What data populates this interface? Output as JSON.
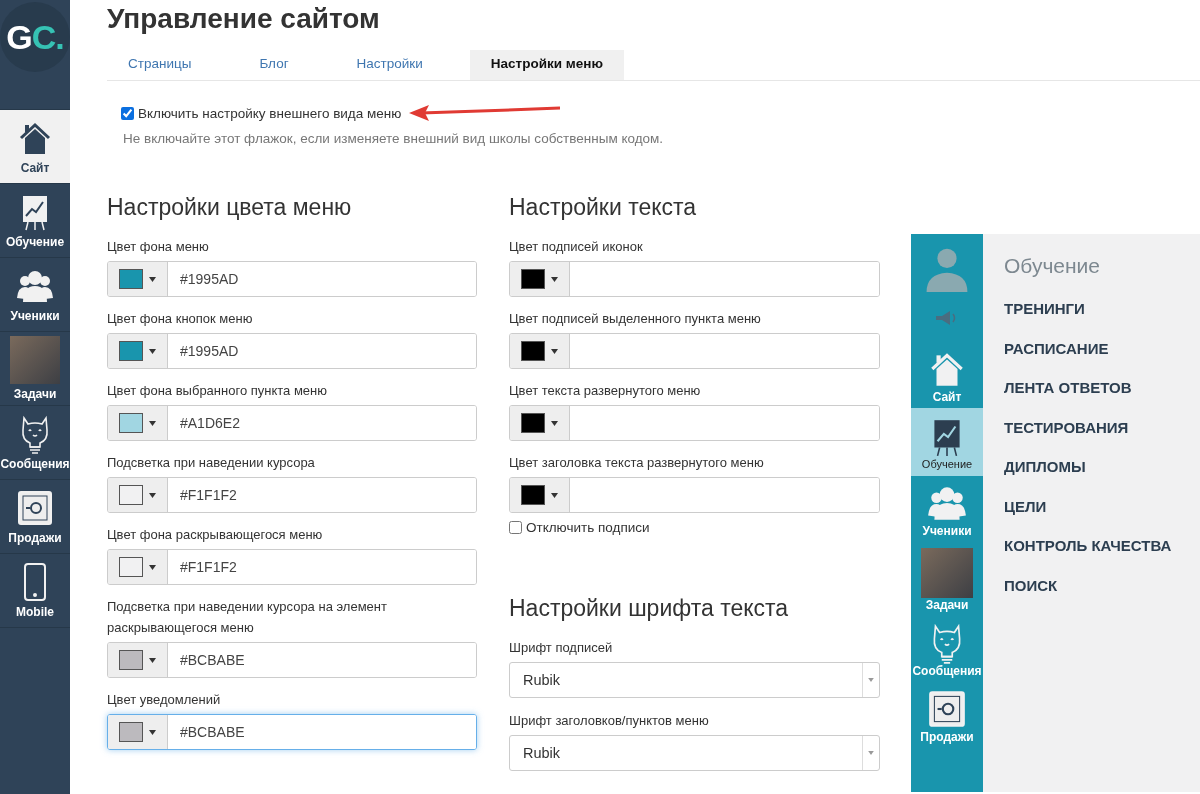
{
  "logo": {
    "main": "G",
    "accent": "C."
  },
  "sidebar": {
    "items": [
      {
        "label": "Сайт",
        "selected": true
      },
      {
        "label": "Обучение",
        "selected": false
      },
      {
        "label": "Ученики",
        "selected": false
      },
      {
        "label": "Задачи",
        "selected": false
      },
      {
        "label": "Сообщения",
        "selected": false
      },
      {
        "label": "Продажи",
        "selected": false
      },
      {
        "label": "Mobile",
        "selected": false
      }
    ]
  },
  "page_title": "Управление сайтом",
  "tabs": [
    {
      "label": "Страницы",
      "selected": false
    },
    {
      "label": "Блог",
      "selected": false
    },
    {
      "label": "Настройки",
      "selected": false
    },
    {
      "label": "Настройки меню",
      "selected": true
    }
  ],
  "enable_option": {
    "label": "Включить настройку внешнего вида меню",
    "checked": true,
    "hint": "Не включайте этот флажок, если изменяете внешний вид школы собственным кодом."
  },
  "color_settings": {
    "title": "Настройки цвета меню",
    "fields": [
      {
        "label": "Цвет фона меню",
        "value": "#1995AD",
        "color": "#1995ad",
        "focused": false
      },
      {
        "label": "Цвет фона кнопок меню",
        "value": "#1995AD",
        "color": "#1995ad",
        "focused": false
      },
      {
        "label": "Цвет фона выбранного пункта меню",
        "value": "#A1D6E2",
        "color": "#a1d6e2",
        "focused": false
      },
      {
        "label": "Подсветка при наведении курсора",
        "value": "#F1F1F2",
        "color": "#f1f1f2",
        "focused": false
      },
      {
        "label": "Цвет фона раскрывающегося меню",
        "value": "#F1F1F2",
        "color": "#f1f1f2",
        "focused": false
      },
      {
        "label": "Подсветка при наведении курсора на элемент раскрывающегося меню",
        "value": "#BCBABE",
        "color": "#bcbabe",
        "focused": false
      },
      {
        "label": "Цвет уведомлений",
        "value": "#BCBABE",
        "color": "#bcbabe",
        "focused": true
      }
    ]
  },
  "text_settings": {
    "title": "Настройки текста",
    "fields": [
      {
        "label": "Цвет подписей иконок",
        "color": "#000000"
      },
      {
        "label": "Цвет подписей выделенного пункта меню",
        "color": "#000000"
      },
      {
        "label": "Цвет текста развернутого меню",
        "color": "#000000"
      },
      {
        "label": "Цвет заголовка текста развернутого меню",
        "color": "#000000"
      }
    ],
    "disable_labels": {
      "label": "Отключить подписи",
      "checked": false
    }
  },
  "font_settings": {
    "title": "Настройки шрифта текста",
    "selects": [
      {
        "label": "Шрифт подписей",
        "value": "Rubik"
      },
      {
        "label": "Шрифт заголовков/пунктов меню",
        "value": "Rubik"
      }
    ]
  },
  "preview": {
    "sidebar_items": [
      {
        "label": "Сайт",
        "selected": false
      },
      {
        "label": "Обучение",
        "selected": true
      },
      {
        "label": "Ученики",
        "selected": false
      },
      {
        "label": "Задачи",
        "selected": false
      },
      {
        "label": "Сообщения",
        "selected": false
      },
      {
        "label": "Продажи",
        "selected": false
      }
    ],
    "menu_title": "Обучение",
    "menu_items": [
      "ТРЕНИНГИ",
      "РАСПИСАНИЕ",
      "ЛЕНТА ОТВЕТОВ",
      "ТЕСТИРОВАНИЯ",
      "ДИПЛОМЫ",
      "ЦЕЛИ",
      "КОНТРОЛЬ КАЧЕСТВА",
      "ПОИСК"
    ]
  }
}
